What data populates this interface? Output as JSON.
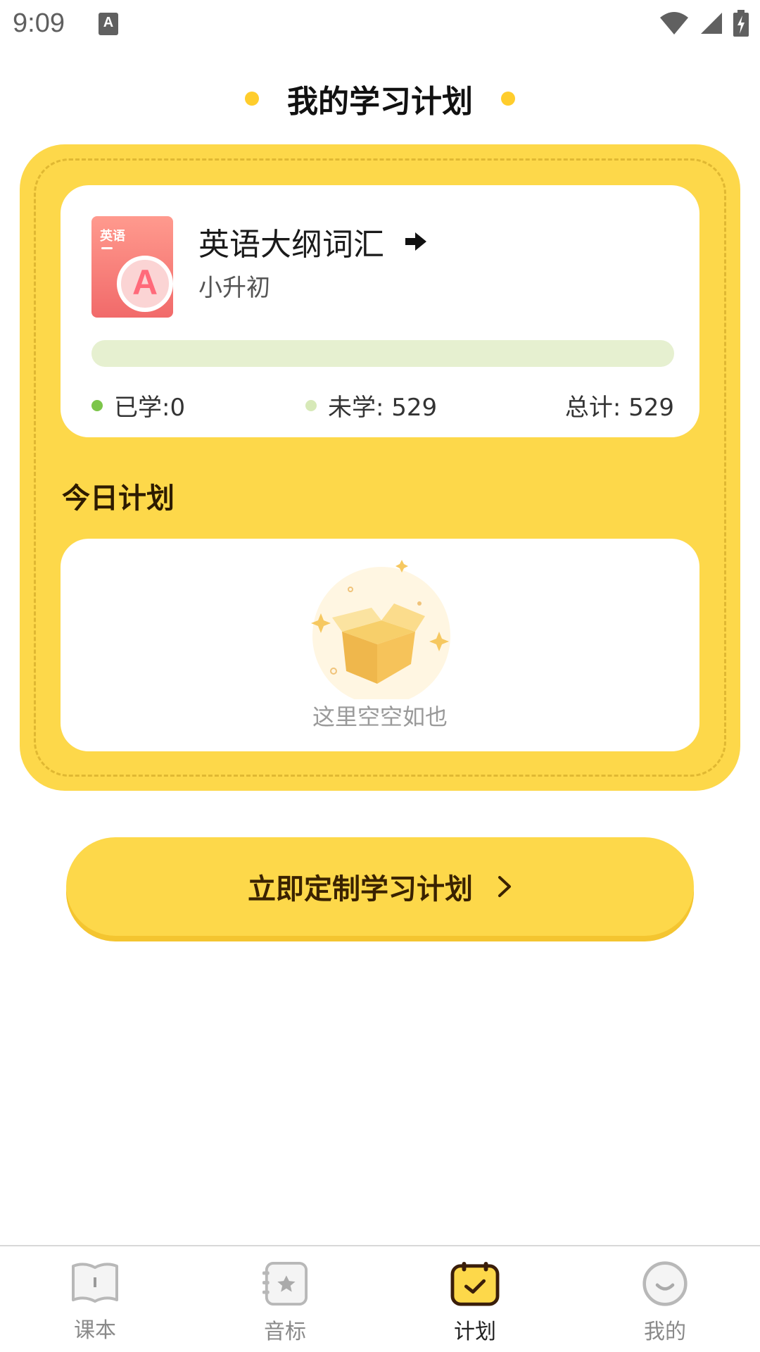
{
  "status_bar": {
    "time": "9:09",
    "notification_badge": "A"
  },
  "header": {
    "title": "我的学习计划"
  },
  "book": {
    "cover_tag": "英语",
    "cover_letter": "A",
    "name": "英语大纲词汇",
    "grade": "小升初",
    "progress_fraction": 0,
    "learned_label": "已学:0",
    "unlearned_label": "未学: 529",
    "total_label": "总计: 529"
  },
  "today": {
    "title": "今日计划",
    "empty_text": "这里空空如也"
  },
  "cta": {
    "label": "立即定制学习计划"
  },
  "tabs": [
    {
      "label": "课本",
      "icon": "book-icon",
      "active": false
    },
    {
      "label": "音标",
      "icon": "phonetic-card-icon",
      "active": false
    },
    {
      "label": "计划",
      "icon": "calendar-check-icon",
      "active": true
    },
    {
      "label": "我的",
      "icon": "smile-face-icon",
      "active": false
    }
  ],
  "colors": {
    "accent_yellow": "#fdd84a",
    "learned_green": "#7cc54a",
    "unlearned_green": "#d7e9b8",
    "title_dot": "#ffcd2c"
  }
}
